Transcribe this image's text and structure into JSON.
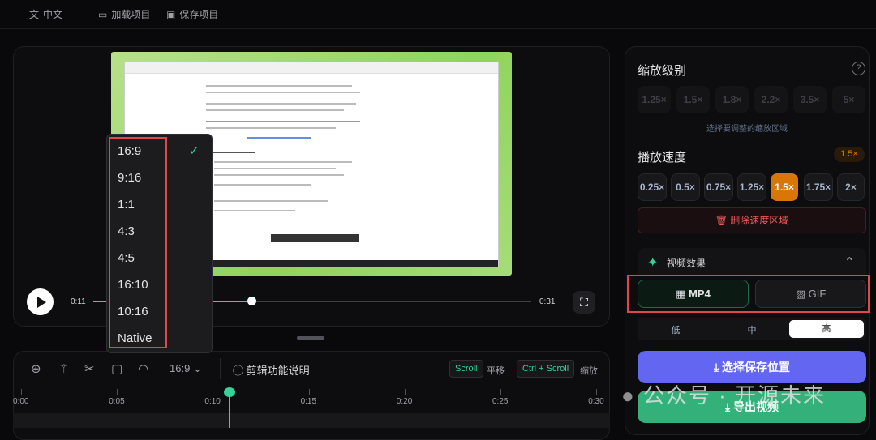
{
  "topbar": {
    "language": "中文",
    "load_project": "加载项目",
    "save_project": "保存项目"
  },
  "player": {
    "current_time": "0:11",
    "duration": "0:31",
    "progress": 0.355
  },
  "aspect_menu": {
    "options": [
      "16:9",
      "9:16",
      "1:1",
      "4:3",
      "4:5",
      "16:10",
      "10:16",
      "Native"
    ],
    "selected": "16:9"
  },
  "timeline": {
    "aspect_label": "16:9",
    "help_label": "剪辑功能说明",
    "scroll_key": "Scroll",
    "scroll_action": "平移",
    "zoom_key": "Ctrl + Scroll",
    "zoom_action": "缩放",
    "ticks": [
      "0:00",
      "0:05",
      "0:10",
      "0:15",
      "0:20",
      "0:25",
      "0:30"
    ],
    "playhead_time": "0:11"
  },
  "right": {
    "zoom_title": "缩放级别",
    "zoom_levels": [
      "1.25×",
      "1.5×",
      "1.8×",
      "2.2×",
      "3.5×",
      "5×"
    ],
    "zoom_hint": "选择要调整的缩放区域",
    "speed_title": "播放速度",
    "speed_badge": "1.5×",
    "speeds": [
      "0.25×",
      "0.5×",
      "0.75×",
      "1.25×",
      "1.5×",
      "1.75×",
      "2×"
    ],
    "speed_selected": "1.5×",
    "delete_speed": "删除速度区域",
    "effects_title": "视频效果",
    "format_mp4": "MP4",
    "format_gif": "GIF",
    "quality": [
      "低",
      "中",
      "高"
    ],
    "quality_selected": "高",
    "choose_location": "选择保存位置",
    "export": "导出视频"
  },
  "watermark": "公众号 · 开源未来",
  "colors": {
    "accent_green": "#34d399",
    "orange": "#d97706",
    "purple": "#6366f1",
    "export_green": "#34b07a",
    "highlight_red": "#e0474c"
  }
}
